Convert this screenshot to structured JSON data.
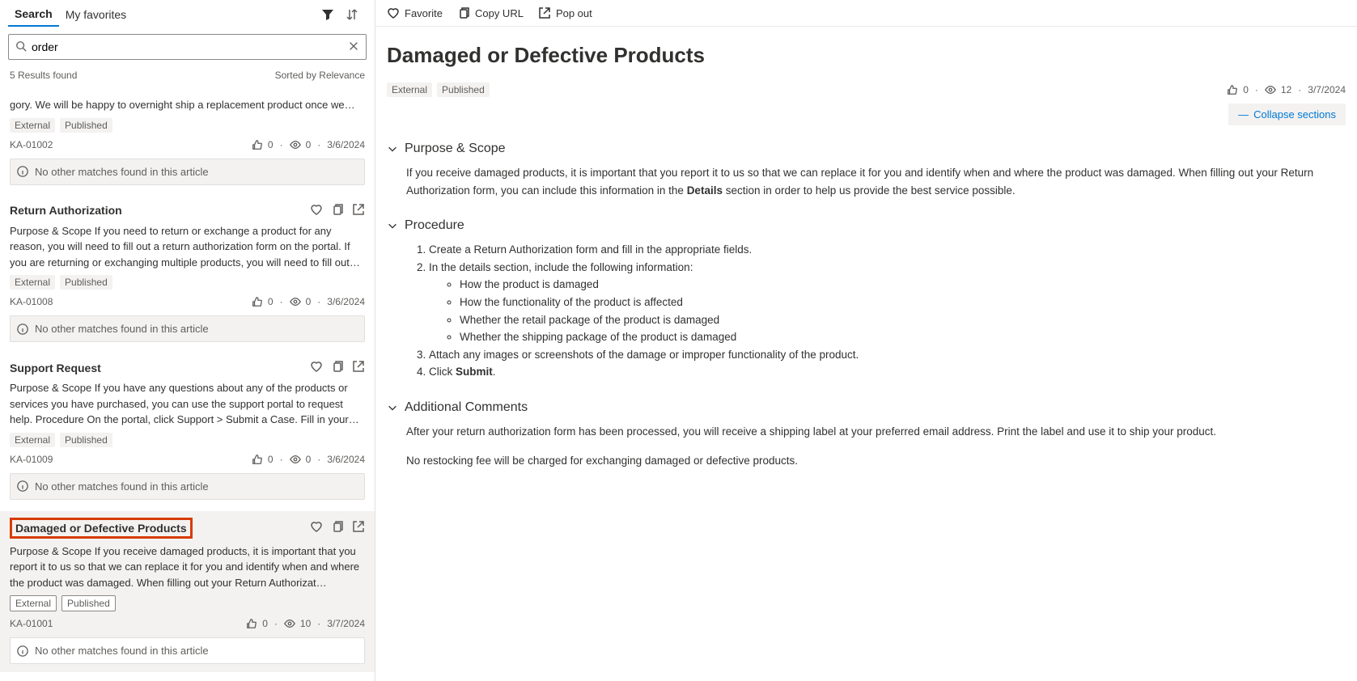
{
  "tabs": {
    "search": "Search",
    "favorites": "My favorites"
  },
  "search": {
    "value": "order"
  },
  "resultsMeta": {
    "count": "5 Results found",
    "sort": "Sorted by Relevance"
  },
  "noMatchText": "No other matches found in this article",
  "results": [
    {
      "title": "",
      "excerpt": "gory. We will be happy to overnight ship a replacement product once we…",
      "tags": [
        "External",
        "Published"
      ],
      "id": "KA-01002",
      "likes": "0",
      "views": "0",
      "date": "3/6/2024",
      "selected": false,
      "short": true,
      "showActions": false
    },
    {
      "title": "Return Authorization",
      "excerpt": "Purpose & Scope If you need to return or exchange a product for any reason, you will need to fill out a return authorization form on the portal. If you are returning or exchanging multiple products, you will need to fill out…",
      "tags": [
        "External",
        "Published"
      ],
      "id": "KA-01008",
      "likes": "0",
      "views": "0",
      "date": "3/6/2024",
      "selected": false,
      "short": false,
      "showActions": true
    },
    {
      "title": "Support Request",
      "excerpt": "Purpose & Scope If you have any questions about any of the products or services you have purchased, you can use the support portal to request help. Procedure On the portal, click Support > Submit a Case. Fill in your n…",
      "tags": [
        "External",
        "Published"
      ],
      "id": "KA-01009",
      "likes": "0",
      "views": "0",
      "date": "3/6/2024",
      "selected": false,
      "short": false,
      "showActions": true
    },
    {
      "title": "Damaged or Defective Products",
      "excerpt": "Purpose & Scope If you receive damaged products, it is important that you report it to us so that we can replace it for you and identify when and where the product was damaged. When filling out your Return Authorizat…",
      "tags": [
        "External",
        "Published"
      ],
      "id": "KA-01001",
      "likes": "0",
      "views": "10",
      "date": "3/7/2024",
      "selected": true,
      "short": false,
      "showActions": true,
      "highlight": true
    }
  ],
  "topActions": {
    "favorite": "Favorite",
    "copy": "Copy URL",
    "pop": "Pop out"
  },
  "article": {
    "title": "Damaged or Defective Products",
    "tags": [
      "External",
      "Published"
    ],
    "likes": "0",
    "views": "12",
    "date": "3/7/2024",
    "collapse": "Collapse sections",
    "sections": {
      "purpose": {
        "title": "Purpose & Scope",
        "body_pre": "If you receive damaged products, it is important that you report it to us so that we can replace it for you and identify when and where the product was damaged. When filling out your Return Authorization form, you can include this information in the ",
        "body_bold": "Details",
        "body_post": " section in order to help us provide the best service possible."
      },
      "procedure": {
        "title": "Procedure",
        "step1": "Create a Return Authorization form and fill in the appropriate fields.",
        "step2": "In the details section, include the following information:",
        "bullets": [
          "How the product is damaged",
          "How the functionality of the product is affected",
          "Whether the retail package of the product is damaged",
          "Whether the shipping package of the product is damaged"
        ],
        "step3": "Attach any images or screenshots of the damage or improper functionality of the product.",
        "step4_pre": "Click ",
        "step4_bold": "Submit",
        "step4_post": "."
      },
      "additional": {
        "title": "Additional Comments",
        "p1": "After your return authorization form has been processed, you will receive a shipping label at your preferred email address. Print the label and use it to ship your product.",
        "p2": "No restocking fee will be charged for exchanging damaged or defective products."
      }
    }
  }
}
